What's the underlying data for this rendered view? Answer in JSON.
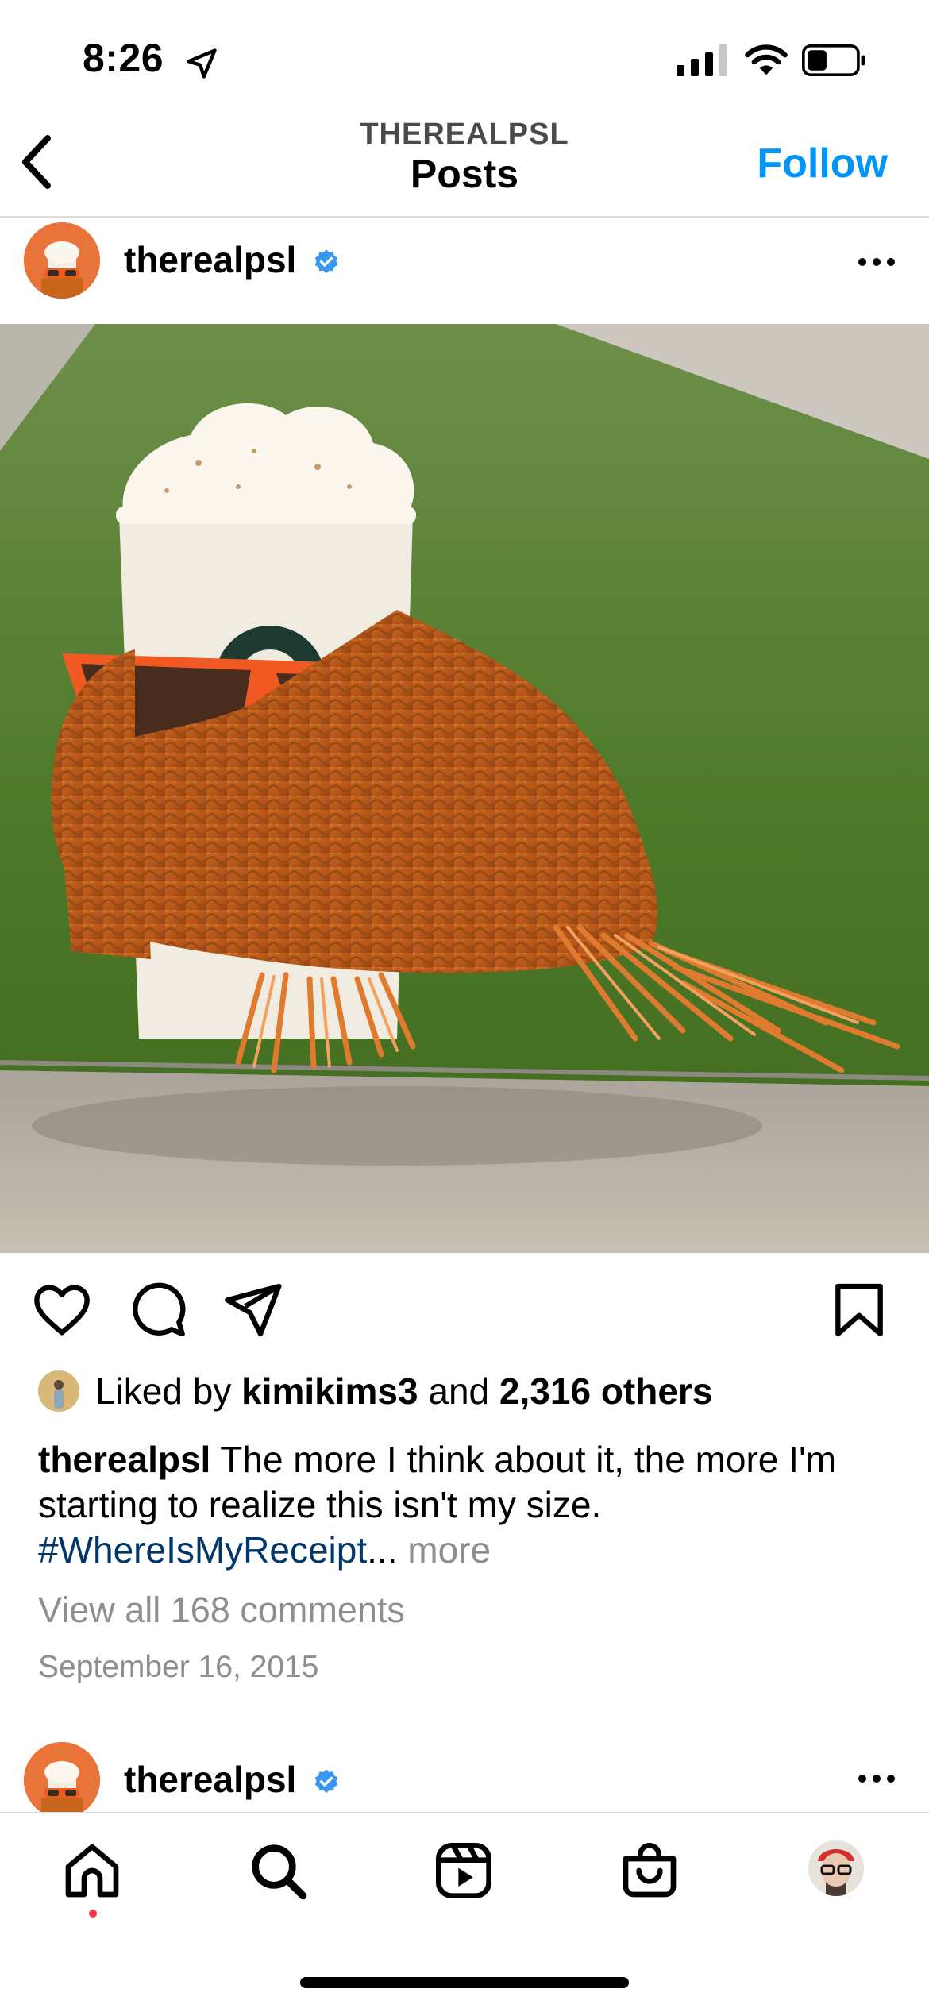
{
  "status_bar": {
    "time": "8:26",
    "icons": [
      "location-arrow-icon",
      "signal-icon",
      "wifi-icon",
      "battery-icon"
    ]
  },
  "header": {
    "subtitle": "THEREALPSL",
    "title": "Posts",
    "follow_label": "Follow",
    "back_icon": "chevron-left-icon"
  },
  "post": {
    "username": "therealpsl",
    "verified": true,
    "liked_by_prefix": "Liked by ",
    "liked_by_user": "kimikims3",
    "liked_by_and": " and ",
    "liked_by_count": "2,316 others",
    "caption_text": " The more I think about it, the more I'm starting to realize this isn't my size.",
    "caption_hashtag": "#WhereIsMyReceipt",
    "caption_ellipsis": "...",
    "more_label": " more",
    "comments_label": "View all 168 comments",
    "date": "September 16, 2015",
    "actions": [
      "heart-icon",
      "comment-icon",
      "share-icon",
      "bookmark-icon"
    ]
  },
  "next_post": {
    "username": "therealpsl",
    "verified": true
  },
  "tab_bar": {
    "items": [
      "home-icon",
      "search-icon",
      "reels-icon",
      "shop-icon",
      "profile-avatar"
    ],
    "active": "home-icon"
  },
  "colors": {
    "accent": "#0095f6",
    "verified": "#3897f0",
    "hashtag": "#00376b",
    "muted": "#8e8e8e",
    "notification_dot": "#ff3040"
  }
}
